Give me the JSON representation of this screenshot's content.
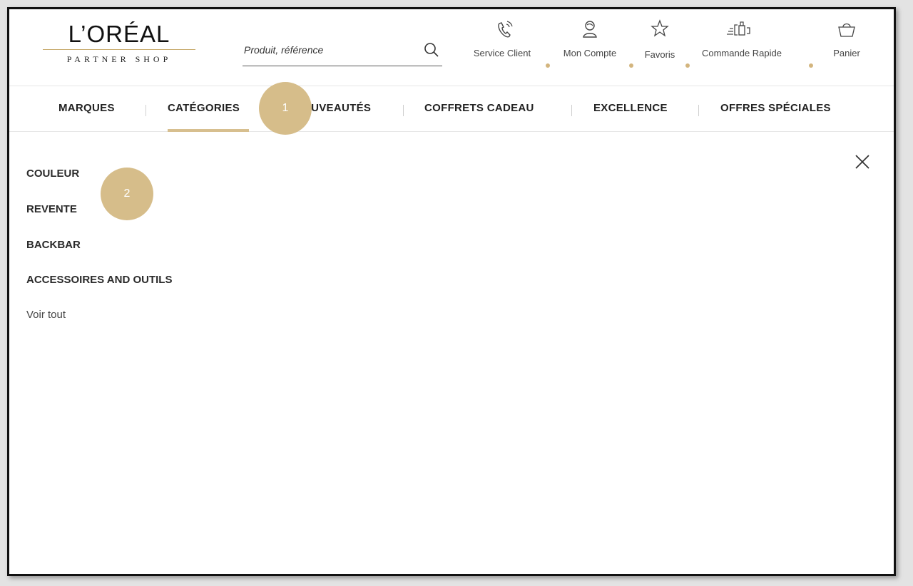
{
  "brand": {
    "name": "L’ORÉAL",
    "sub": "PARTNER SHOP"
  },
  "search": {
    "placeholder": "Produit, référence",
    "value": ""
  },
  "utility": {
    "items": [
      {
        "label": "Service Client",
        "icon": "phone-icon"
      },
      {
        "label": "Mon Compte",
        "icon": "user-icon"
      },
      {
        "label": "Favoris",
        "icon": "star-icon"
      },
      {
        "label": "Commande Rapide",
        "icon": "quick-order-icon"
      },
      {
        "label": "Panier",
        "icon": "basket-icon"
      }
    ]
  },
  "nav": {
    "items": [
      {
        "label": "MARQUES"
      },
      {
        "label": "CATÉGORIES"
      },
      {
        "label": "NOUVEAUTÉS"
      },
      {
        "label": "COFFRETS CADEAU"
      },
      {
        "label": "EXCELLENCE"
      },
      {
        "label": "OFFRES SPÉCIALES"
      }
    ],
    "active": "CATÉGORIES"
  },
  "annotations": {
    "badge1": "1",
    "badge2": "2"
  },
  "menu": {
    "items": [
      {
        "label": "COULEUR"
      },
      {
        "label": "REVENTE"
      },
      {
        "label": "BACKBAR"
      },
      {
        "label": "ACCESSOIRES AND OUTILS"
      }
    ],
    "view_all": "Voir tout"
  },
  "colors": {
    "accent": "#d6bd8a",
    "gold_rule": "#c7aa6d",
    "text": "#222222"
  }
}
